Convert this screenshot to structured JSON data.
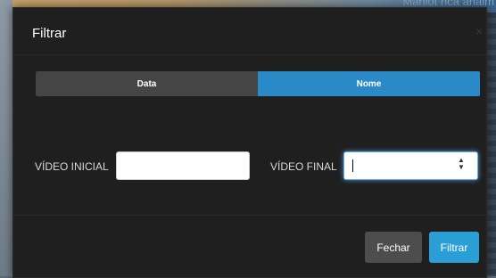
{
  "background": {
    "text": "Maniot nca anaim"
  },
  "modal": {
    "title": "Filtrar",
    "close_glyph": "×",
    "tabs": [
      {
        "label": "Data",
        "active": false
      },
      {
        "label": "Nome",
        "active": true
      }
    ],
    "fields": {
      "initial_label": "VÍDEO INICIAL",
      "initial_value": "",
      "final_label": "VÍDEO FINAL",
      "final_value": ""
    },
    "buttons": {
      "close_label": "Fechar",
      "filter_label": "Filtrar"
    }
  },
  "colors": {
    "modal_bg": "#1f1f1f",
    "active_tab": "#2a8ac7",
    "inactive_tab": "#454545",
    "primary_button": "#2a9fd6",
    "secondary_button": "#4d4d4d"
  },
  "icons": {
    "close": "close-icon",
    "spinner": "spinner-arrows-icon"
  }
}
